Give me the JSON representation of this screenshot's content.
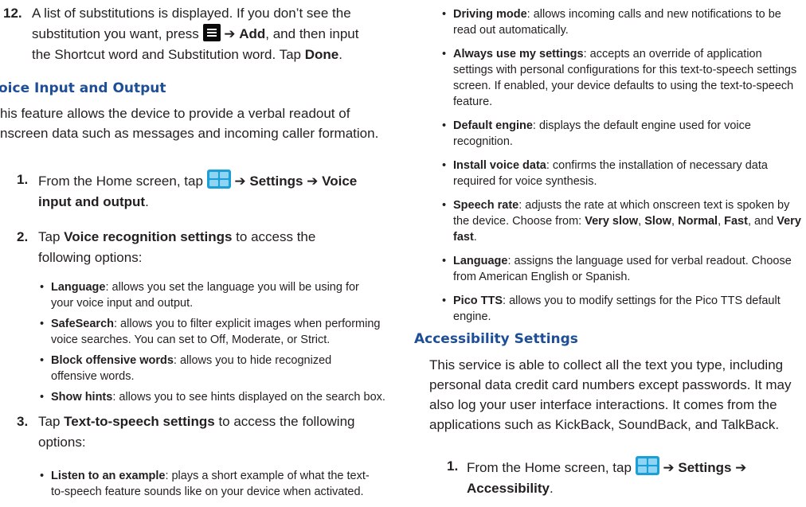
{
  "left": {
    "step12": {
      "num": "12.",
      "t1": "A list of substitutions is displayed. If you don’t see the substitution you want, press",
      "arrow": "➔",
      "add": "Add",
      "t2": ", and then input the Shortcut word and Substitution word. Tap",
      "done": "Done",
      "end": "."
    },
    "heading": "oice Input and Output",
    "intro": "his feature allows the device to provide a verbal readout of nscreen data such as messages and incoming caller formation.",
    "step1": {
      "num": "1.",
      "t1": "From the Home screen, tap",
      "arrow1": "➔",
      "settings": "Settings",
      "arrow2": "➔",
      "vio": "Voice input and output",
      "end": "."
    },
    "step2": {
      "num": "2.",
      "t1": "Tap",
      "vrs": "Voice recognition settings",
      "t2": "to access the following options:"
    },
    "bullets2": [
      {
        "term": "Language",
        "desc": ": allows you set the language you will be using for your voice input and output."
      },
      {
        "term": "SafeSearch",
        "desc": ": allows you to filter explicit images when performing voice searches. You can set to Off, Moderate, or Strict."
      },
      {
        "term": "Block offensive words",
        "desc": ": allows you to hide recognized offensive words."
      },
      {
        "term": "Show hints",
        "desc": ": allows you to see hints displayed on the search box."
      }
    ],
    "step3": {
      "num": "3.",
      "t1": "Tap",
      "tts": "Text-to-speech settings",
      "t2": "to access the following options:"
    },
    "bullets3": [
      {
        "term": "Listen to an example",
        "desc": ": plays a short example of what the text-to-speech feature sounds like on your device when activated."
      }
    ]
  },
  "right": {
    "bullets": [
      {
        "term": "Driving mode",
        "desc": ": allows incoming calls and new notifications to be read out automatically."
      },
      {
        "term": "Always use my settings",
        "desc": ": accepts an override of application settings with personal configurations for this text-to-speech settings screen. If enabled, your device defaults to using the text-to-speech feature."
      },
      {
        "term": "Default engine",
        "desc": ": displays the default engine used for voice recognition."
      },
      {
        "term": "Install voice data",
        "desc": ": confirms the installation of necessary data required for voice synthesis."
      }
    ],
    "speech": {
      "term": "Speech rate",
      "desc": ": adjusts the rate at which onscreen text is spoken by the device. Choose from:",
      "o1": "Very slow",
      "s1": ",",
      "o2": "Slow",
      "s2": ",",
      "o3": "Normal",
      "s3": ",",
      "o4": "Fast",
      "and": ", and",
      "o5": "Very fast",
      "end": "."
    },
    "bullets_b": [
      {
        "term": "Language",
        "desc": ": assigns the language used for verbal readout. Choose from American English or Spanish."
      },
      {
        "term": "Pico TTS",
        "desc": ": allows you to modify settings for the Pico TTS default engine."
      }
    ],
    "heading": "Accessibility Settings",
    "para": "This service is able to collect all the text you type, including personal data credit card numbers except passwords. It may also log your user interface interactions. It comes from the applications such as KickBack, SoundBack, and TalkBack.",
    "step1": {
      "num": "1.",
      "t1": "From the Home screen, tap",
      "arrow1": "➔",
      "settings": "Settings",
      "arrow2": "➔",
      "acc": "Accessibility",
      "end": "."
    }
  }
}
